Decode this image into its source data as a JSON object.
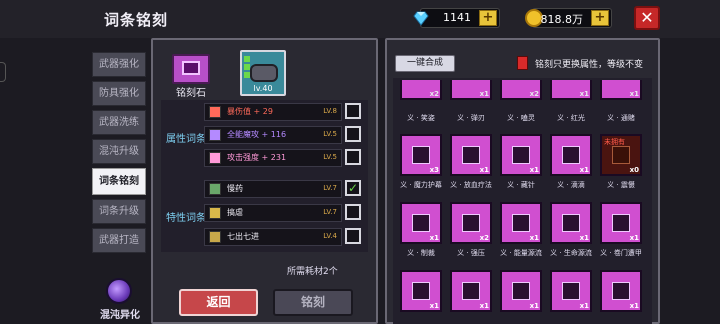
{
  "header": {
    "title": "词条铭刻",
    "gems": "1141",
    "gold": "818.8万",
    "close_icon": "close-icon"
  },
  "side_tabs": [
    {
      "label": "武器强化",
      "active": false
    },
    {
      "label": "防具强化",
      "active": false
    },
    {
      "label": "武器洗练",
      "active": false
    },
    {
      "label": "混沌升级",
      "active": false
    },
    {
      "label": "词条铭刻",
      "active": true
    },
    {
      "label": "词条升级",
      "active": false
    },
    {
      "label": "武器打造",
      "active": false
    }
  ],
  "chaos": {
    "label": "混沌异化"
  },
  "left": {
    "stone_label": "铭刻石",
    "weapon_level": "lv.40",
    "attr_section": "属性词条",
    "trait_section": "特性词条",
    "attr_rows": [
      {
        "name": "暴伤值 + 29",
        "level": "LV.8",
        "color": "#ff6a5a",
        "checked": false
      },
      {
        "name": "全能魔攻 + 116",
        "level": "LV.5",
        "color": "#b48aff",
        "checked": false
      },
      {
        "name": "攻击强度 + 231",
        "level": "LV.5",
        "color": "#ff9ad8",
        "checked": false
      }
    ],
    "trait_rows": [
      {
        "name": "慢药",
        "level": "LV.7",
        "color": "#f0eef6",
        "checked": true
      },
      {
        "name": "搞虐",
        "level": "LV.7",
        "color": "#f0eef6",
        "checked": false
      },
      {
        "name": "七出七进",
        "level": "LV.4",
        "color": "#f0eef6",
        "checked": false
      }
    ],
    "need_text": "所需耗材2个",
    "back_label": "返回",
    "engrave_label": "铭刻"
  },
  "right": {
    "oneclick_label": "一键合成",
    "note": "铭刻只更换属性，等级不变",
    "top_row": [
      {
        "label": "义 · 笑姿",
        "qty": "x2"
      },
      {
        "label": "义 · 弹刃",
        "qty": "x1"
      },
      {
        "label": "义 · 嗑灵",
        "qty": "x2"
      },
      {
        "label": "义 · 红光",
        "qty": "x1"
      },
      {
        "label": "义 · 通赌",
        "qty": "x1"
      }
    ],
    "mid_row": [
      {
        "label": "义 · 魔力护幕",
        "qty": "x3"
      },
      {
        "label": "义 · 放血疗法",
        "qty": "x1"
      },
      {
        "label": "义 · 藏针",
        "qty": "x1"
      },
      {
        "label": "义 · 滴滴",
        "qty": "x1"
      },
      {
        "label": "义 · 震慑",
        "qty": "x0",
        "unowned": "未拥有"
      }
    ],
    "bot_row": [
      {
        "label": "义 · 制裁",
        "qty": "x1"
      },
      {
        "label": "义 · 强压",
        "qty": "x2"
      },
      {
        "label": "义 · 能量源流",
        "qty": "x1"
      },
      {
        "label": "义 · 生命源流",
        "qty": "x1"
      },
      {
        "label": "义 · 卷门遭甲",
        "qty": "x1"
      }
    ],
    "last_row": [
      {
        "qty": "x1"
      },
      {
        "qty": "x1"
      },
      {
        "qty": "x1"
      },
      {
        "qty": "x1"
      },
      {
        "qty": "x1"
      }
    ]
  }
}
